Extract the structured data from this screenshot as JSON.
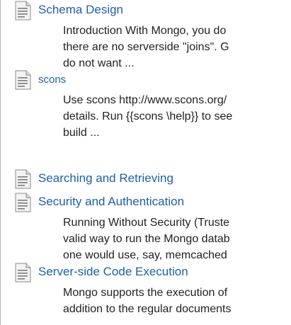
{
  "results": [
    {
      "title": "Schema Design",
      "excerpt": [
        "Introduction With Mongo, you do",
        "there are no serverside \"joins\". G",
        "do not want ..."
      ]
    },
    {
      "title": "scons",
      "excerpt": [
        "Use scons http://www.scons.org/",
        "details. Run {{scons \\help}} to see",
        "build ..."
      ]
    },
    {
      "title": "Searching and Retrieving",
      "excerpt": []
    },
    {
      "title": "Security and Authentication",
      "excerpt": [
        "Running Without Security (Truste",
        "valid way to run the Mongo datab",
        "one would use, say, memcached"
      ]
    },
    {
      "title": "Server-side Code Execution",
      "excerpt": [
        "Mongo supports the execution of",
        "addition to the regular documents"
      ]
    }
  ],
  "icons": {
    "result_icon": "page-document-icon"
  },
  "colors": {
    "link": "#1f5fa8",
    "text": "#222222"
  }
}
